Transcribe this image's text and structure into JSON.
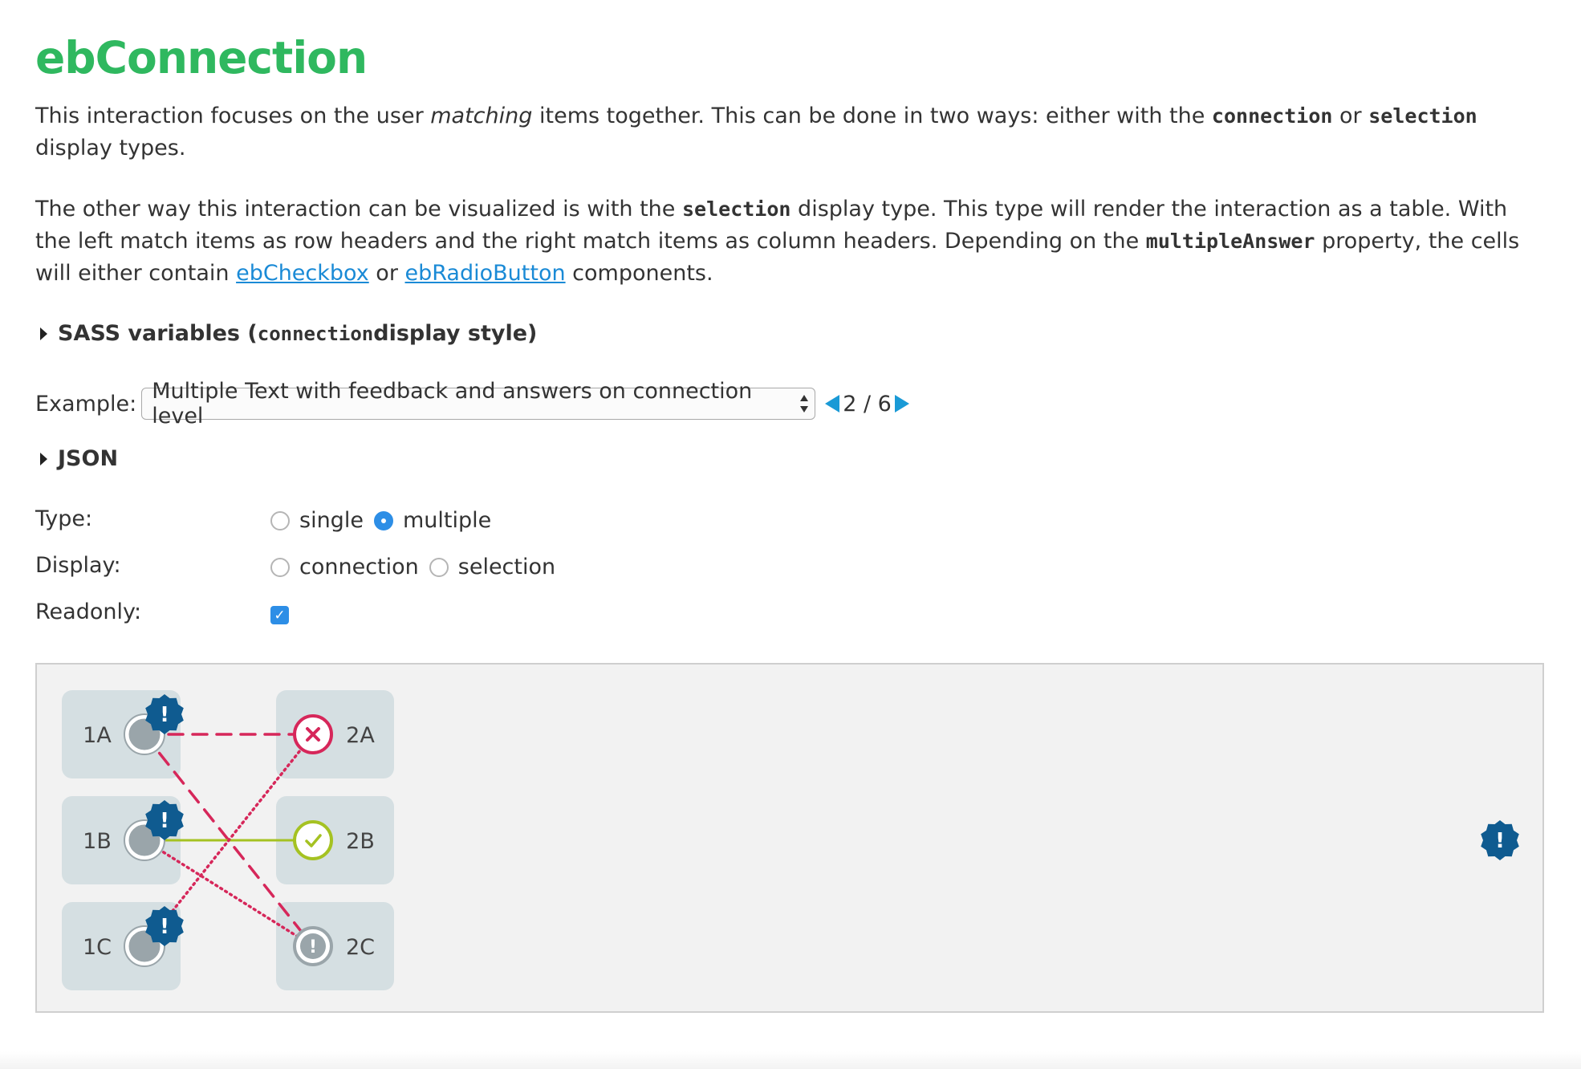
{
  "title": "ebConnection",
  "intro": {
    "t1": "This interaction focuses on the user ",
    "t2": "matching",
    "t3": " items together. This can be done in two ways: either with the ",
    "c1": "connection",
    "t4": " or ",
    "c2": "selection",
    "t5": " display types."
  },
  "second": {
    "t1": "The other way this interaction can be visualized is with the ",
    "c1": "selection",
    "t2": " display type. This type will render the interaction as a table. With the left match items as row headers and the right match items as column headers. Depending on the ",
    "c2": "multipleAnswer",
    "t3": " property, the cells will either contain ",
    "link1": "ebCheckbox",
    "t4": " or ",
    "link2": "ebRadioButton",
    "t5": " components."
  },
  "sass_toggle": {
    "t1": "SASS variables (",
    "code": "connection",
    "t2": " display style)"
  },
  "example": {
    "label": "Example:",
    "selected": "Multiple Text with feedback and answers on connection level",
    "pager": "2 / 6"
  },
  "json_toggle": "JSON",
  "options": {
    "type": {
      "label": "Type:",
      "choices": [
        "single",
        "multiple"
      ],
      "selected": "multiple"
    },
    "display": {
      "label": "Display:",
      "choices": [
        "connection",
        "selection"
      ],
      "selected": ""
    },
    "readonly": {
      "label": "Readonly:",
      "checked": true
    }
  },
  "connection": {
    "left_items": [
      "1A",
      "1B",
      "1C"
    ],
    "right_items": [
      "2A",
      "2B",
      "2C"
    ],
    "right_states": [
      "incorrect",
      "correct",
      "feedback"
    ],
    "links": [
      {
        "from": "1A",
        "to": "2A",
        "style": "dashed"
      },
      {
        "from": "1A",
        "to": "2C",
        "style": "dashed"
      },
      {
        "from": "1B",
        "to": "2B",
        "style": "solid"
      },
      {
        "from": "1B",
        "to": "2C",
        "style": "dotted"
      },
      {
        "from": "1C",
        "to": "2A",
        "style": "dotted"
      }
    ],
    "feedback_badge_glyph": "!",
    "colors": {
      "item_bg": "#d5dfe2",
      "handle_gray": "#9aa5aa",
      "badge_blue": "#0f5b90",
      "incorrect_pink": "#d6275a",
      "correct_green": "#a5c222",
      "feedback_gray": "#9aa5aa"
    }
  },
  "colors": {
    "title_green": "#2fb85f",
    "link_blue": "#1a8ad6",
    "accent_blue": "#2d8ee6"
  }
}
